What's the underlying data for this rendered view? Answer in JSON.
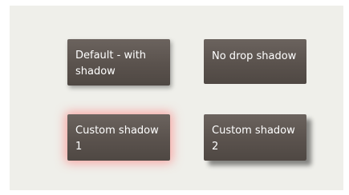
{
  "buttons": {
    "default_label": "Default - with shadow",
    "nodrop_label": "No drop shadow",
    "custom1_label": "Custom shadow 1",
    "custom2_label": "Custom shadow 2"
  },
  "colors": {
    "page_background": "#efefea",
    "button_face": "#5a524d",
    "button_text": "#ffffff",
    "custom_shadow_1": "#ff6e6e",
    "shadow": "#000000"
  }
}
